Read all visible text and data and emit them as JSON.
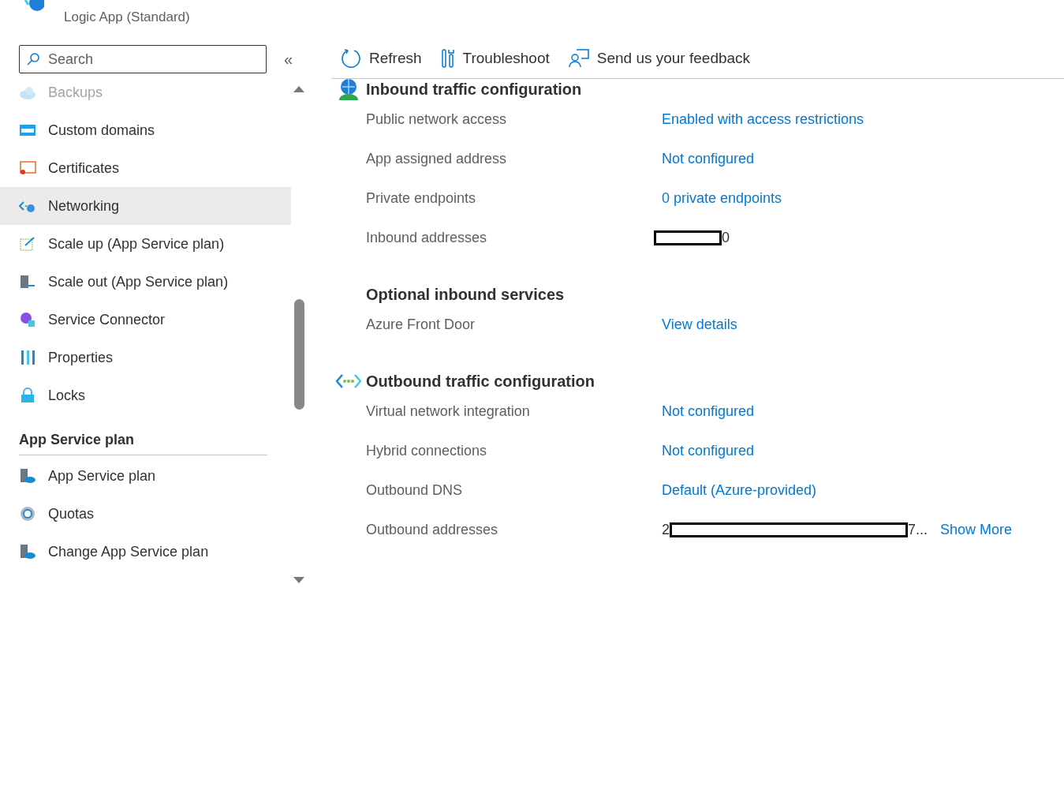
{
  "header": {
    "subtitle": "Logic App (Standard)"
  },
  "search": {
    "placeholder": "Search"
  },
  "collapse": "«",
  "sidebar": {
    "items": [
      {
        "label": "Backups",
        "selected": false,
        "faded": true
      },
      {
        "label": "Custom domains",
        "selected": false,
        "faded": false
      },
      {
        "label": "Certificates",
        "selected": false,
        "faded": false
      },
      {
        "label": "Networking",
        "selected": true,
        "faded": false
      },
      {
        "label": "Scale up (App Service plan)",
        "selected": false,
        "faded": false
      },
      {
        "label": "Scale out (App Service plan)",
        "selected": false,
        "faded": false
      },
      {
        "label": "Service Connector",
        "selected": false,
        "faded": false
      },
      {
        "label": "Properties",
        "selected": false,
        "faded": false
      },
      {
        "label": "Locks",
        "selected": false,
        "faded": false
      }
    ],
    "section": {
      "title": "App Service plan",
      "items": [
        {
          "label": "App Service plan",
          "selected": false
        },
        {
          "label": "Quotas",
          "selected": false
        },
        {
          "label": "Change App Service plan",
          "selected": false
        }
      ]
    }
  },
  "toolbar": [
    "Refresh",
    "Troubleshoot",
    "Send us your feedback"
  ],
  "sections": [
    {
      "title": "Inbound traffic configuration",
      "kind": "inbound",
      "rows": [
        {
          "label": "Public network access",
          "kind": "link",
          "value": "Enabled with access restrictions"
        },
        {
          "label": "App assigned address",
          "kind": "link",
          "value": "Not configured"
        },
        {
          "label": "Private endpoints",
          "kind": "link",
          "value": "0 private endpoints"
        },
        {
          "label": "Inbound addresses",
          "kind": "redacted",
          "after": "0"
        }
      ]
    },
    {
      "title": "Optional inbound services",
      "kind": "optional",
      "rows": [
        {
          "label": "Azure Front Door",
          "kind": "link",
          "value": "View details"
        }
      ]
    },
    {
      "title": "Outbound traffic configuration",
      "kind": "outbound",
      "rows": [
        {
          "label": "Virtual network integration",
          "kind": "link",
          "value": "Not configured"
        },
        {
          "label": "Hybrid connections",
          "kind": "link",
          "value": "Not configured"
        },
        {
          "label": "Outbound DNS",
          "kind": "link",
          "value": "Default (Azure-provided)"
        },
        {
          "label": "Outbound addresses",
          "kind": "redacted",
          "before": "2",
          "after": "7...",
          "link": "Show More"
        }
      ]
    }
  ]
}
